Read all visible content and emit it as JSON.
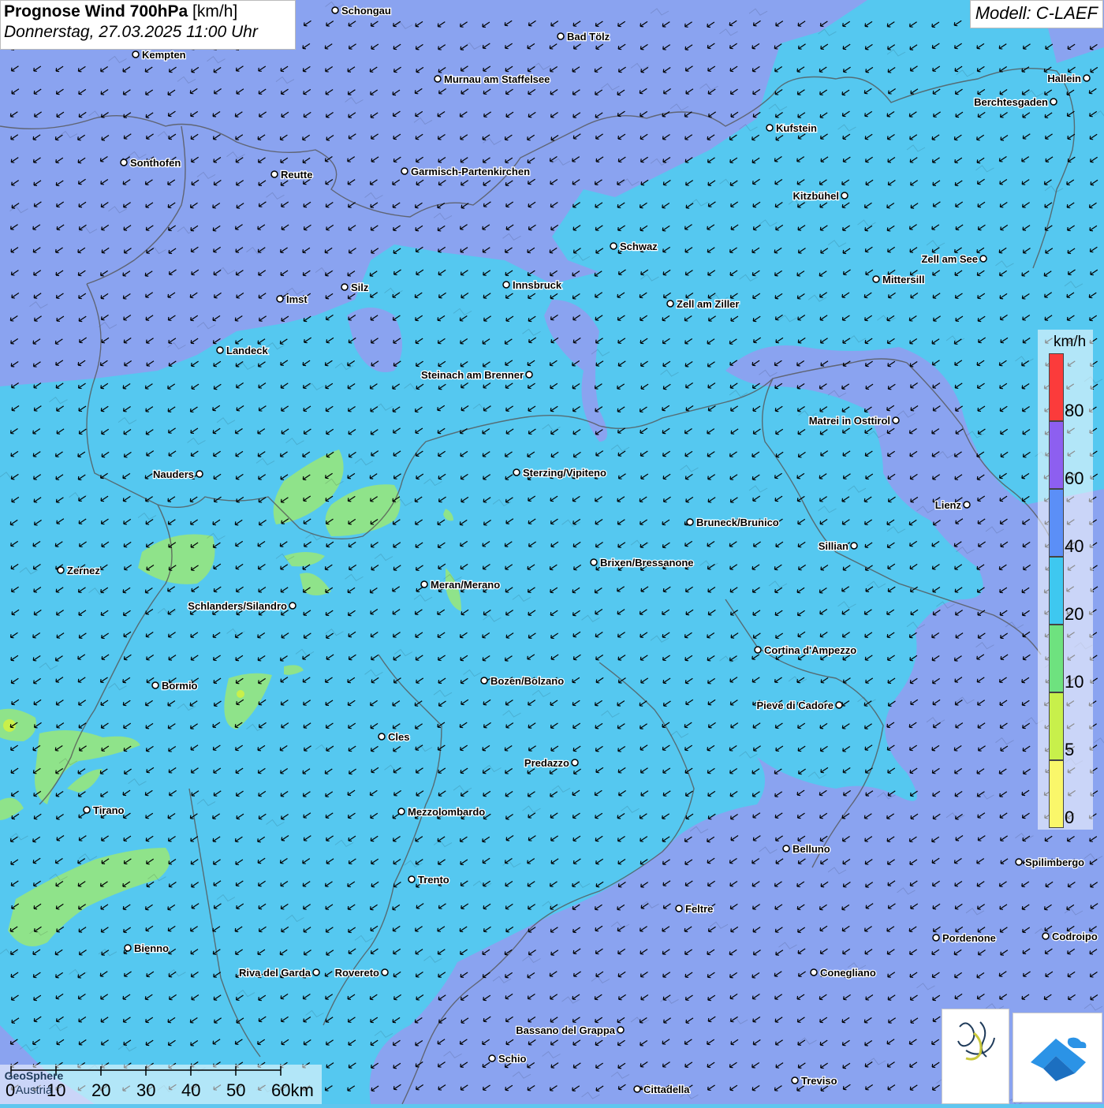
{
  "header": {
    "title_bold": "Prognose Wind 700hPa",
    "title_unit": "[km/h]",
    "datetime": "Donnerstag, 27.03.2025 11:00 Uhr",
    "model": "Modell: C-LAEF"
  },
  "legend": {
    "unit": "km/h",
    "labels": [
      "80",
      "60",
      "40",
      "20",
      "10",
      "5",
      "0"
    ],
    "colors": [
      "#fb3b3b",
      "#8d5ff0",
      "#5b8ff7",
      "#3ec8f0",
      "#6ee27f",
      "#c8f04b",
      "#faf76a"
    ]
  },
  "scalebar": {
    "labels": [
      "0",
      "10",
      "20",
      "30",
      "40",
      "50",
      "60km"
    ]
  },
  "cities": [
    {
      "name": "Schongau",
      "label_pos": "right"
    },
    {
      "name": "Bad Tölz",
      "label_pos": "right"
    },
    {
      "name": "Kempten",
      "label_pos": "right"
    },
    {
      "name": "Murnau am Staffelsee",
      "label_pos": "right"
    },
    {
      "name": "Hallein",
      "label_pos": "left"
    },
    {
      "name": "Berchtesgaden",
      "label_pos": "left"
    },
    {
      "name": "Kufstein",
      "label_pos": "right"
    },
    {
      "name": "Sonthofen",
      "label_pos": "right"
    },
    {
      "name": "Reutte",
      "label_pos": "right"
    },
    {
      "name": "Garmisch-Partenkirchen",
      "label_pos": "right"
    },
    {
      "name": "Kitzbühel",
      "label_pos": "left"
    },
    {
      "name": "Schwaz",
      "label_pos": "right"
    },
    {
      "name": "Zell am See",
      "label_pos": "left"
    },
    {
      "name": "Mittersill",
      "label_pos": "right"
    },
    {
      "name": "Innsbruck",
      "label_pos": "right"
    },
    {
      "name": "Silz",
      "label_pos": "right"
    },
    {
      "name": "Imst",
      "label_pos": "right"
    },
    {
      "name": "Zell am Ziller",
      "label_pos": "right"
    },
    {
      "name": "Landeck",
      "label_pos": "right"
    },
    {
      "name": "Steinach am Brenner",
      "label_pos": "left"
    },
    {
      "name": "Matrei in Osttirol",
      "label_pos": "left"
    },
    {
      "name": "Nauders",
      "label_pos": "left"
    },
    {
      "name": "Sterzing/Vipiteno",
      "label_pos": "right"
    },
    {
      "name": "Lienz",
      "label_pos": "left"
    },
    {
      "name": "Bruneck/Brunico",
      "label_pos": "right"
    },
    {
      "name": "Sillian",
      "label_pos": "left"
    },
    {
      "name": "Brixen/Bressanone",
      "label_pos": "right"
    },
    {
      "name": "Zernez",
      "label_pos": "right"
    },
    {
      "name": "Meran/Merano",
      "label_pos": "right"
    },
    {
      "name": "Schlanders/Silandro",
      "label_pos": "left"
    },
    {
      "name": "Cortina d'Ampezzo",
      "label_pos": "right"
    },
    {
      "name": "Bozen/Bolzano",
      "label_pos": "right"
    },
    {
      "name": "Bormio",
      "label_pos": "right"
    },
    {
      "name": "Pieve di Cadore",
      "label_pos": "left"
    },
    {
      "name": "Cles",
      "label_pos": "right"
    },
    {
      "name": "Predazzo",
      "label_pos": "left"
    },
    {
      "name": "Tirano",
      "label_pos": "right"
    },
    {
      "name": "Mezzolombardo",
      "label_pos": "right"
    },
    {
      "name": "Belluno",
      "label_pos": "right"
    },
    {
      "name": "Spilimbergo",
      "label_pos": "right"
    },
    {
      "name": "Trento",
      "label_pos": "right"
    },
    {
      "name": "Feltre",
      "label_pos": "right"
    },
    {
      "name": "Pordenone",
      "label_pos": "right"
    },
    {
      "name": "Codroipo",
      "label_pos": "right"
    },
    {
      "name": "Bienno",
      "label_pos": "right"
    },
    {
      "name": "Riva del Garda",
      "label_pos": "left"
    },
    {
      "name": "Rovereto",
      "label_pos": "left"
    },
    {
      "name": "Conegliano",
      "label_pos": "right"
    },
    {
      "name": "Bassano del Grappa",
      "label_pos": "left"
    },
    {
      "name": "Schio",
      "label_pos": "right"
    },
    {
      "name": "Treviso",
      "label_pos": "right"
    },
    {
      "name": "Cittadella",
      "label_pos": "right"
    }
  ],
  "logos": {
    "geosphere_line1": "GeoSphere",
    "geosphere_line2": "Austria",
    "icons": [
      "geosphere-logo-icon",
      "cloud-logo-icon"
    ]
  },
  "wind": {
    "direction": "from north-east",
    "glyph": "arrow-southwest"
  },
  "colors": {
    "band_0_5": "#faf76a",
    "band_5_10": "#c8f04b",
    "band_10_20": "#8ee57a",
    "band_20_40": "#55c8f0",
    "band_40_60": "#7f9ef2",
    "border": "#555555"
  }
}
